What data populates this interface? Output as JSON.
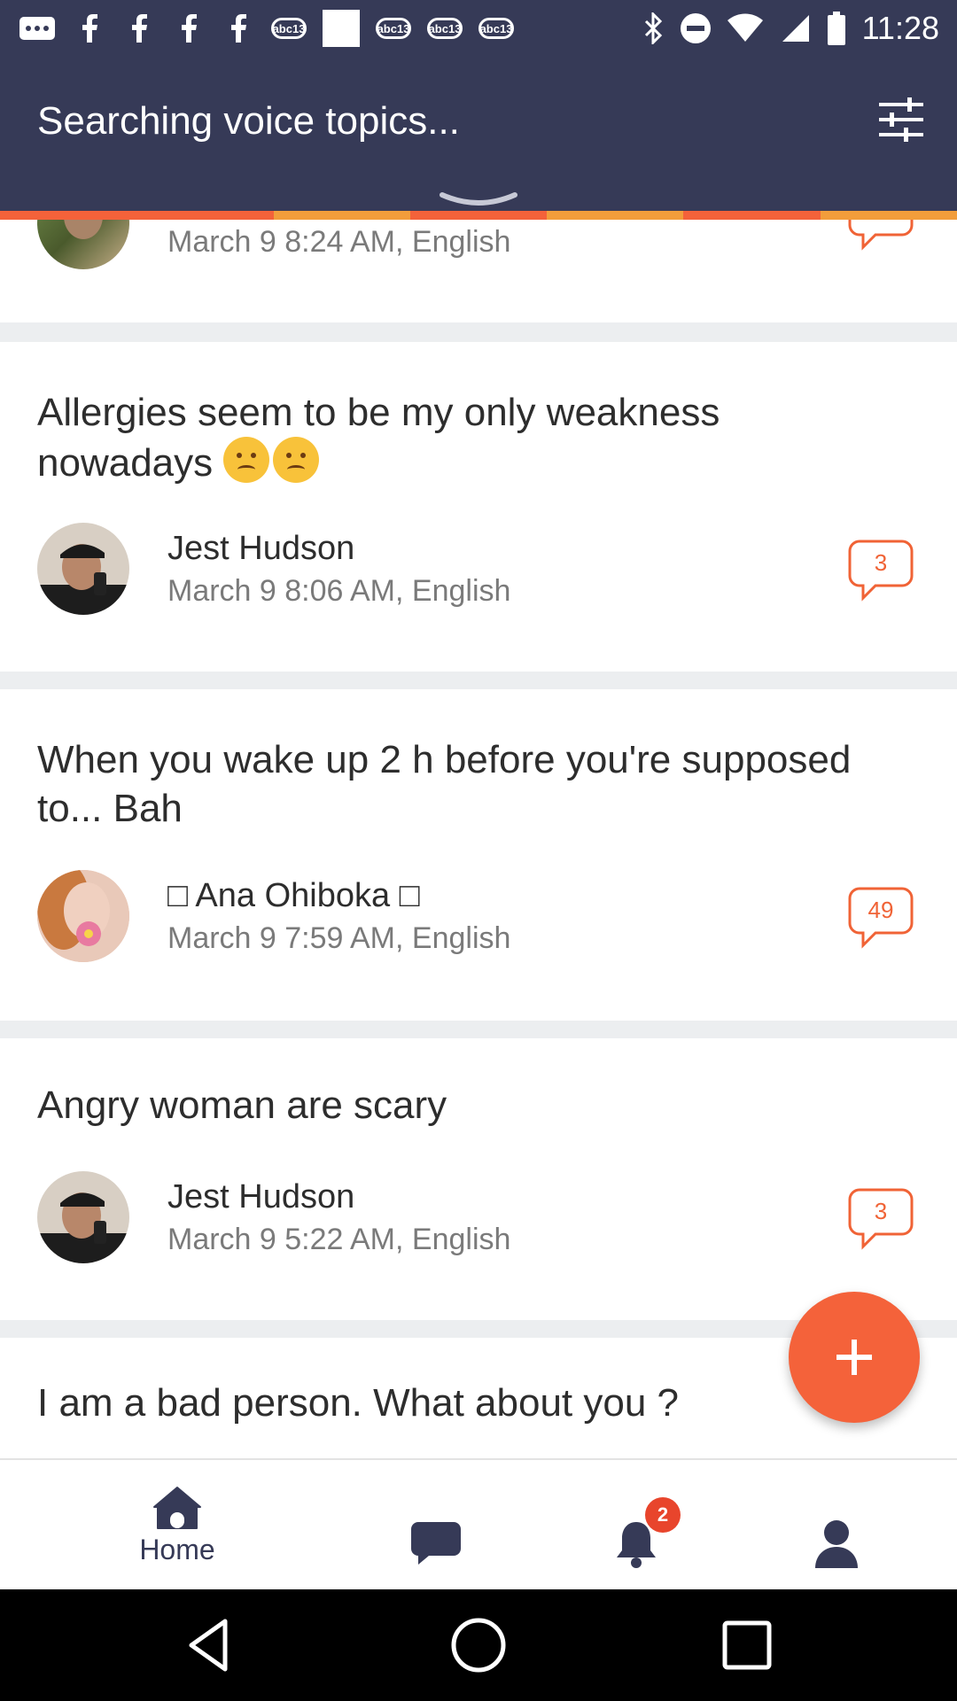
{
  "status_bar": {
    "time": "11:28",
    "left_icons": [
      "messages-icon",
      "facebook-icon",
      "facebook-icon",
      "facebook-icon",
      "facebook-icon",
      "abc13-icon",
      "white-square-icon",
      "abc13-icon",
      "abc13-icon",
      "abc13-icon"
    ],
    "abc_label": "abc13"
  },
  "header": {
    "title": "Searching voice topics...",
    "progress_colors": [
      "#f4623a",
      "#f4623a",
      "#f29d3b",
      "#f4623a",
      "#f29d3b",
      "#f4623a",
      "#f29d3b"
    ]
  },
  "feed": {
    "partial": {
      "meta": "March 9 8:24 AM, English"
    },
    "posts": [
      {
        "title": "Allergies seem to be my only weakness nowadays",
        "author": "Jest Hudson",
        "meta": "March 9 8:06 AM, English",
        "comments": "3"
      },
      {
        "title": "When you wake up 2 h before you're supposed to... Bah",
        "author": "□ Ana Ohiboka □",
        "meta": "March 9 7:59 AM, English",
        "comments": "49"
      },
      {
        "title": "Angry woman are scary",
        "author": "Jest Hudson",
        "meta": "March 9 5:22 AM, English",
        "comments": "3"
      },
      {
        "title": "I am a bad person. What about you ?"
      }
    ]
  },
  "bottom_nav": {
    "home_label": "Home",
    "notification_count": "2"
  },
  "colors": {
    "header_bg": "#363a57",
    "accent": "#f4623a"
  }
}
